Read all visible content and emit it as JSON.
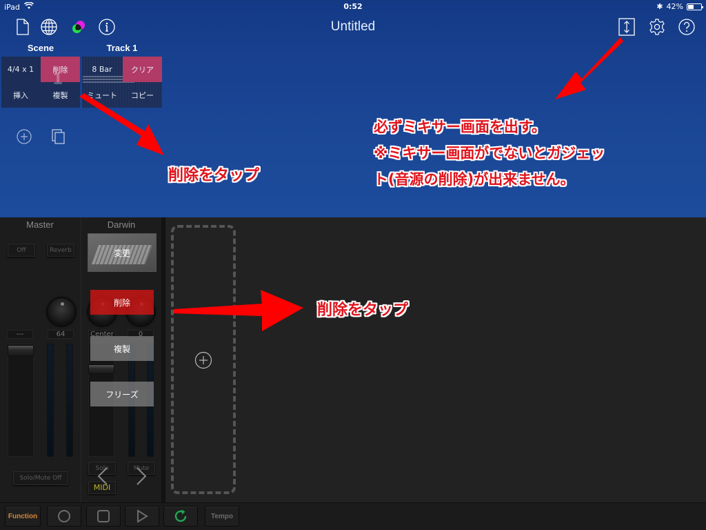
{
  "status_bar": {
    "device": "iPad",
    "time": "0:52",
    "battery": "42%"
  },
  "header": {
    "title": "Untitled",
    "left_icons": [
      "document-icon",
      "globe-icon",
      "color-mix-icon",
      "info-icon"
    ],
    "right_icons": [
      "resize-vertical-icon",
      "gear-icon",
      "help-icon"
    ]
  },
  "scene_panel": {
    "label": "Scene",
    "time_signature": "4/4 x 1",
    "delete": "削除",
    "insert": "挿入",
    "duplicate": "複製",
    "number": "1"
  },
  "track_panel": {
    "label": "Track 1",
    "length": "8 Bar",
    "clear": "クリア",
    "mute": "ミュート",
    "copy": "コピー"
  },
  "annotations": {
    "tap_delete_top": "削除をタップ",
    "mixer_note_line1": "必ずミキサー画面を出す。",
    "mixer_note_line2": "※ミキサー画面がでないとガジェッ",
    "mixer_note_line3": "ト(音源の削除)が出来ません。",
    "tap_delete_bottom": "削除をタップ",
    "arrow_color": "#ff0000"
  },
  "mixer": {
    "master": {
      "label": "Master",
      "off": "Off",
      "reverb": "Reverb",
      "readout_left": "---",
      "readout_right": "64",
      "solo_mute_off": "Solo/Mute Off"
    },
    "darwin": {
      "label": "Darwin",
      "change": "変更",
      "delete": "削除",
      "duplicate": "複製",
      "freeze": "フリーズ",
      "pan_readout": "Center",
      "value_readout": "0",
      "solo": "Solo",
      "mute": "Mute",
      "midi": "MIDI"
    }
  },
  "transport": {
    "function": "Function",
    "tempo": "Tempo",
    "function_color": "#d9883a",
    "loop_color": "#1faa52"
  }
}
